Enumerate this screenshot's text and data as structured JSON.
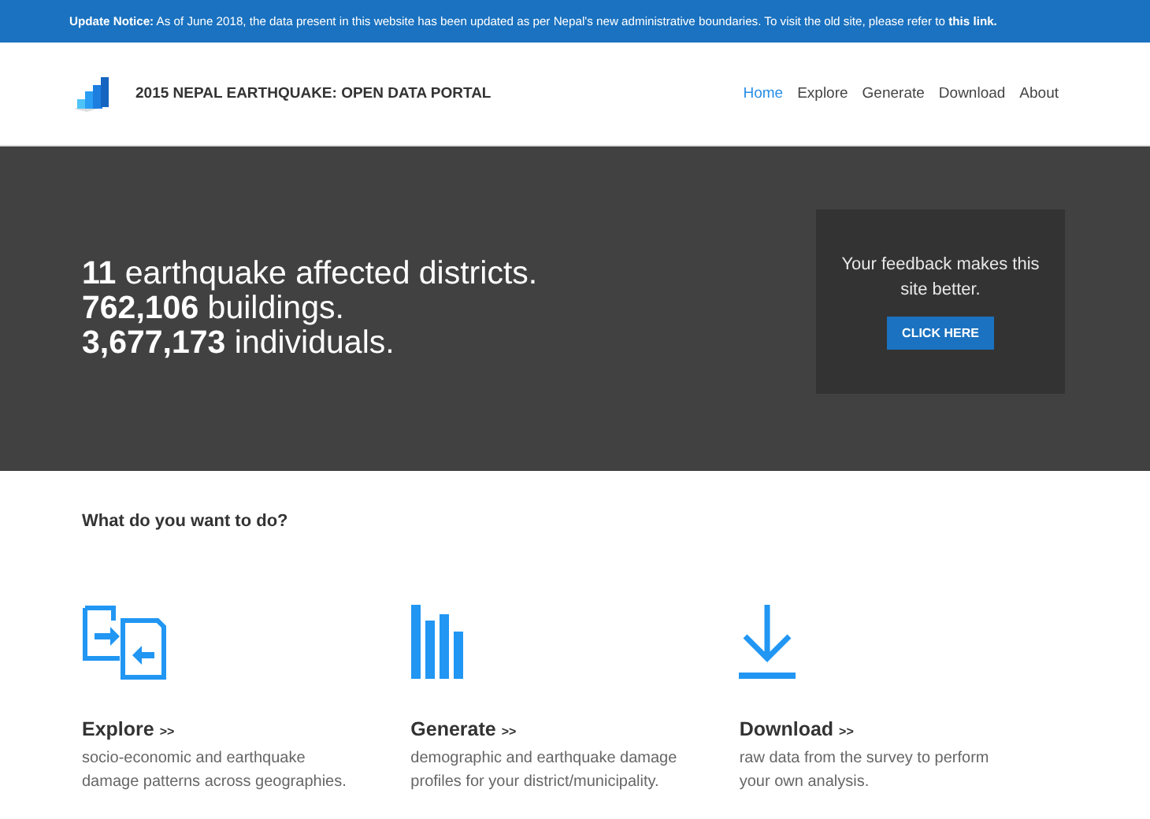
{
  "notice": {
    "text": "**Update Notice:** As of June 2018, the data present in this website has been updated as per Nepal's new administrative boundaries. To visit the old site, please refer to",
    "link": "this link."
  },
  "header": {
    "title": "2015 NEPAL EARTHQUAKE: OPEN DATA PORTAL",
    "nav": [
      {
        "label": "Home",
        "selected": true
      },
      {
        "label": "Explore",
        "selected": false
      },
      {
        "label": "Generate",
        "selected": false
      },
      {
        "label": "Download",
        "selected": false
      },
      {
        "label": "About",
        "selected": false
      }
    ]
  },
  "hero": {
    "stats": [
      {
        "number": "11",
        "text": "earthquake affected districts."
      },
      {
        "number": "762,106",
        "text": "buildings."
      },
      {
        "number": "3,677,173",
        "text": "individuals."
      }
    ],
    "feedback": {
      "text": "Your feedback makes this site better.",
      "button": "CLICK HERE"
    }
  },
  "section": {
    "title": "What do you want to do?",
    "cards": [
      {
        "kind": "explore",
        "title": "Explore",
        "arrow": ">>",
        "description": "socio-economic and earthquake damage patterns across geographies."
      },
      {
        "kind": "generate",
        "title": "Generate",
        "arrow": ">>",
        "description": "demographic and earthquake damage profiles for your district/municipality."
      },
      {
        "kind": "download",
        "title": "Download",
        "arrow": ">>",
        "description": "raw data from the survey to perform your own analysis."
      }
    ]
  }
}
